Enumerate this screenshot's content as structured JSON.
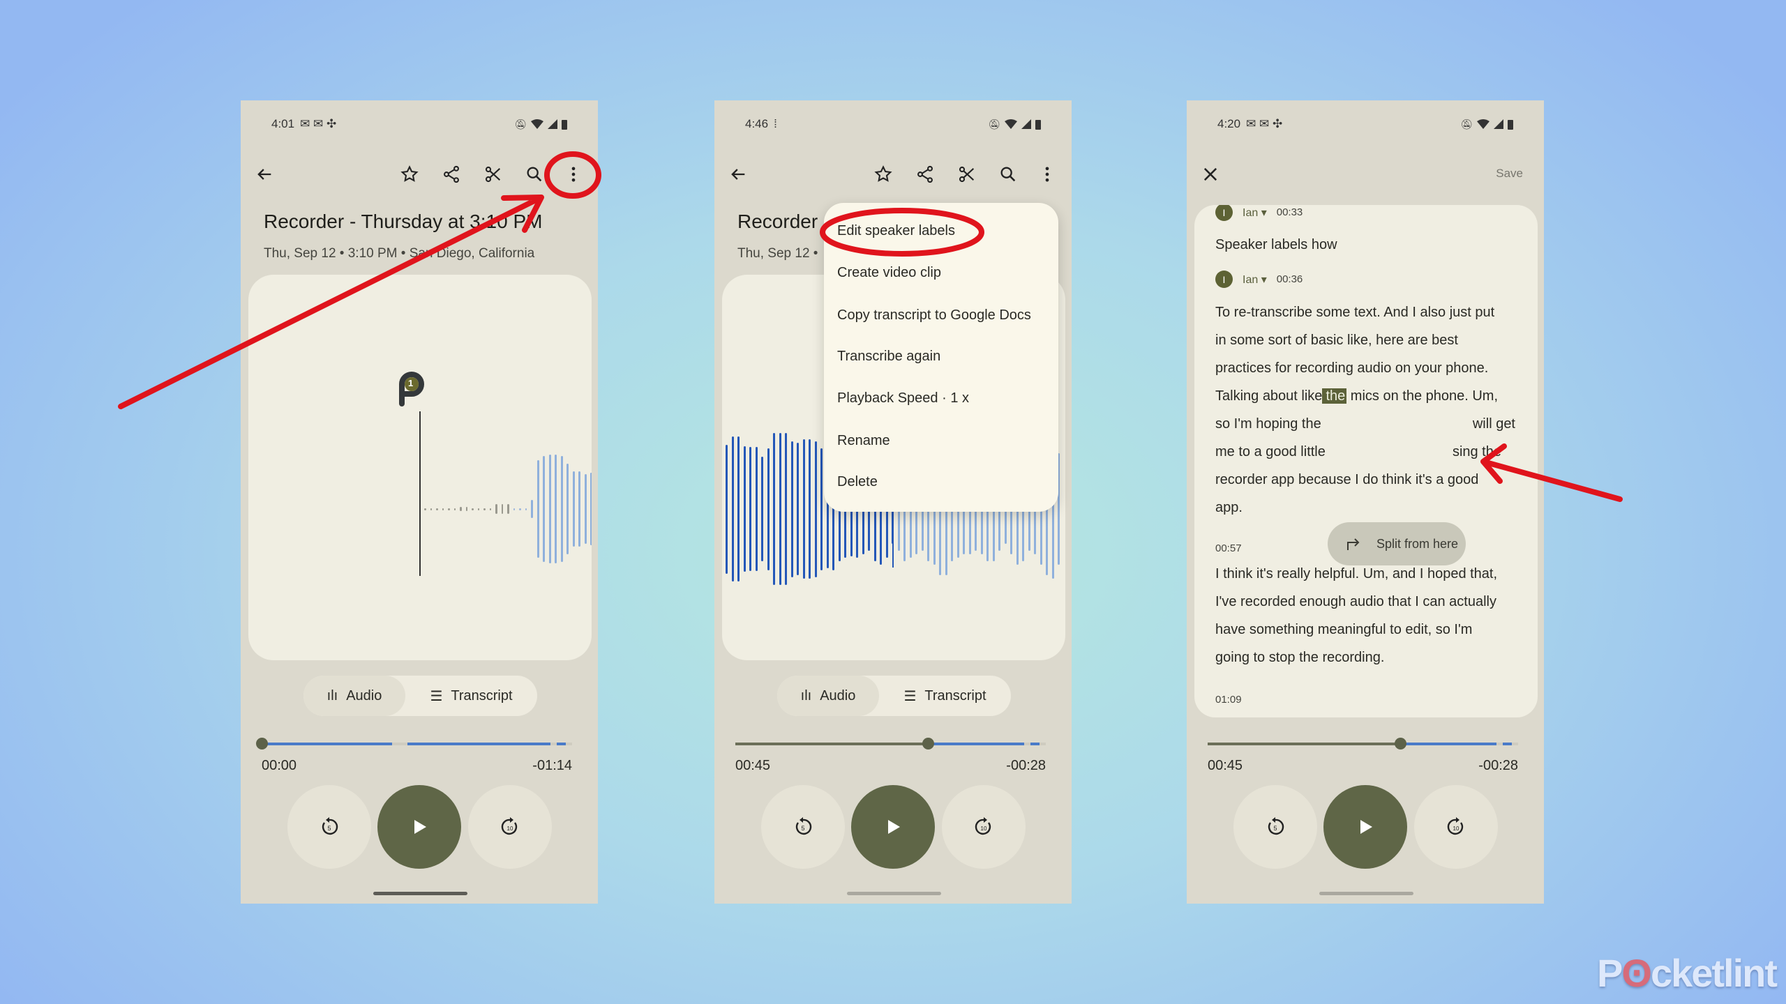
{
  "colors": {
    "accent_olive": "#5f6647",
    "waveform_blue": "#2457b8",
    "waveform_light": "#8fb0dc",
    "progress_blue": "#4a7bc8",
    "annotation_red": "#e0141c"
  },
  "phone1": {
    "status": {
      "time": "4:01"
    },
    "toolbar": {
      "icons": [
        "back-arrow-icon",
        "star-icon",
        "share-icon",
        "scissors-icon",
        "search-icon",
        "more-vert-icon"
      ]
    },
    "title": "Recorder - Thursday at 3:10 PM",
    "subtitle": "Thu, Sep 12 • 3:10 PM • San Diego, California",
    "marker_label": "1",
    "tabs": {
      "audio": "Audio",
      "transcript": "Transcript",
      "selected": "Audio"
    },
    "progress": {
      "fraction": 0,
      "current": "00:00",
      "remaining": "-01:14"
    },
    "controls": {
      "rewind": "5",
      "forward": "10"
    }
  },
  "phone2": {
    "status": {
      "time": "4:46"
    },
    "title": "Recorder",
    "subtitle": "Thu, Sep 12 •",
    "menu": [
      "Edit speaker labels",
      "Create video clip",
      "Copy transcript to Google Docs",
      "Transcribe again",
      "Playback Speed · 1 x",
      "Rename",
      "Delete"
    ],
    "tabs": {
      "audio": "Audio",
      "transcript": "Transcript",
      "selected": "Audio"
    },
    "progress": {
      "fraction": 0.62,
      "current": "00:45",
      "remaining": "-00:28"
    },
    "controls": {
      "rewind": "5",
      "forward": "10"
    }
  },
  "phone3": {
    "status": {
      "time": "4:20"
    },
    "save": "Save",
    "transcript": {
      "blocks": [
        {
          "speaker": "Ian",
          "avatar": "I",
          "time": "00:33",
          "lines": [
            "Speaker labels how"
          ]
        },
        {
          "speaker": "Ian",
          "avatar": "I",
          "time": "00:36",
          "line1": "To re-transcribe some text. And I also just put",
          "line2": "in some sort of basic like, here are best",
          "line3": "practices for recording audio on your phone.",
          "line4a": "Talking about like",
          "line4_selected": "the",
          "line4b": " mics on the phone. Um,",
          "line5a": "so I'm hoping the",
          "line5b": "will get",
          "line6a": "me to a good little",
          "line6b": "sing the",
          "line7": "recorder app because I do think it's a good",
          "line8": "app."
        },
        {
          "time": "00:57",
          "line1": "I think it's really helpful. Um, and I hoped that,",
          "line2": "I've recorded enough audio that I can actually",
          "line3": "have something meaningful to edit, so I'm",
          "line4": "going to stop the recording."
        },
        {
          "time": "01:09"
        }
      ]
    },
    "tooltip": "Split from here",
    "progress": {
      "fraction": 0.62,
      "current": "00:45",
      "remaining": "-00:28"
    },
    "controls": {
      "rewind": "5",
      "forward": "10"
    }
  },
  "watermark": "Pocket-lint"
}
